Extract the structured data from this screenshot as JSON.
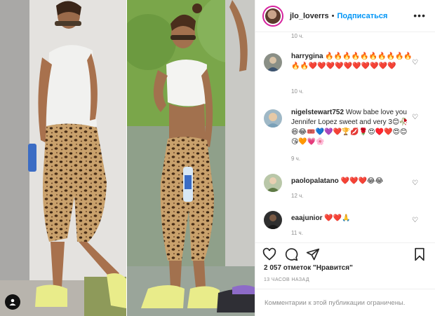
{
  "post": {
    "username": "jlo_loverrs",
    "separator": "•",
    "follow_label": "Подписаться",
    "more_icon": "more-horizontal-icon",
    "top_time": "10 ч."
  },
  "comments": [
    {
      "user": "harrygina",
      "text": "🔥🔥🔥🔥🔥🔥🔥🔥🔥🔥🔥🔥❤️❤️❤️❤️❤️❤️❤️❤️❤️❤️",
      "time": "10 ч."
    },
    {
      "user": "nigelstewart752",
      "text": "Wow babe love you Jennifer Lopez sweet and very 3😊🥀😆😂🎟️💙💜❤️🏆💋🌹😍♥️❤️😍😊😘🧡💗🌸",
      "time": "9 ч."
    },
    {
      "user": "paolopalatano",
      "text": "❤️❤️❤️😂😂",
      "time": "12 ч."
    },
    {
      "user": "eaajunior",
      "text": "❤️❤️🙏",
      "time": "11 ч."
    }
  ],
  "actions": {
    "like_icon": "heart-outline-icon",
    "comment_icon": "comment-icon",
    "share_icon": "send-icon",
    "save_icon": "bookmark-icon"
  },
  "likes_text": "2 057 отметок \"Нравится\"",
  "posted_time": "13 ЧАСОВ НАЗАД",
  "comments_limited": "Комментарии к этой публикации ограничены.",
  "colors": {
    "link_blue": "#0095f6",
    "muted": "#8e8e8e",
    "text": "#262626",
    "border": "#efefef"
  }
}
